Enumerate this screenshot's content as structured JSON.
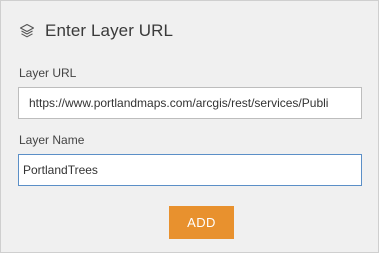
{
  "header": {
    "title": "Enter Layer URL",
    "icon": "layers-icon"
  },
  "form": {
    "url_label": "Layer URL",
    "url_value": "https://www.portlandmaps.com/arcgis/rest/services/Publi",
    "name_label": "Layer Name",
    "name_value": "PortlandTrees",
    "add_label": "ADD"
  },
  "colors": {
    "panel_bg": "#f0f0f0",
    "accent_button": "#e8912e",
    "focus_border": "#5b8fc7"
  }
}
